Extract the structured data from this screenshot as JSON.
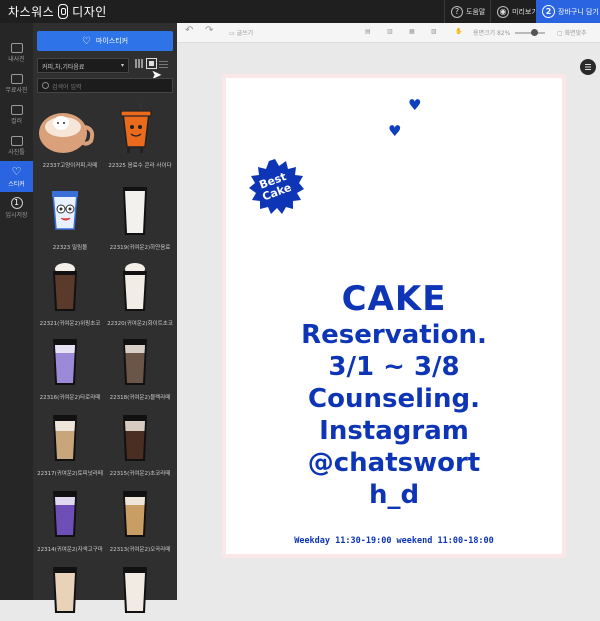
{
  "topbar": {
    "brand_left": "차스워스",
    "brand_right": "디자인",
    "help_num": "?",
    "help_label": "도움말",
    "preview_label": "미리보기",
    "cart_num": "2",
    "cart_label": "장바구니 담기"
  },
  "rail": {
    "items": [
      {
        "label": "내사진"
      },
      {
        "label": "무료사진"
      },
      {
        "label": "컬러"
      },
      {
        "label": "사진틀"
      },
      {
        "label": "스티커"
      },
      {
        "label": "임시저장",
        "num": "1"
      }
    ]
  },
  "panel": {
    "my_sticker_label": "마이스티커",
    "category_value": "커피,차,기타음료",
    "search_placeholder": "검색어 입력",
    "stickers": [
      {
        "caption": "22337고양이커피,라떼"
      },
      {
        "caption": "22325 음료수 콘라 사이다"
      },
      {
        "caption": "22323 밀림몰"
      },
      {
        "caption": "22319(귀여운2)하얀음료"
      },
      {
        "caption": "22321(귀여운2)위핑초코"
      },
      {
        "caption": "22320(귀여운2)화이트초코"
      },
      {
        "caption": "22316(귀여운2)타로라떼"
      },
      {
        "caption": "22318(귀여운2)블랙라떼"
      },
      {
        "caption": "22317(귀여운2)토피넛라떼"
      },
      {
        "caption": "22315(귀여운2)초코라떼"
      },
      {
        "caption": "22314(귀여운2)자색고구마"
      },
      {
        "caption": "22313(귀여운2)오곡라떼"
      },
      {
        "caption": ""
      },
      {
        "caption": ""
      }
    ]
  },
  "toolbar": {
    "undo": "↶",
    "redo": "↷",
    "tool_label": "글쓰기",
    "zoom_label": "용면크기 82%",
    "fit_label": "화면맞추"
  },
  "design": {
    "badge_line1": "Best",
    "badge_line2": "Cake",
    "heart": "♥",
    "lines": [
      "CAKE",
      "Reservation.",
      "3/1 ~ 3/8",
      "Counseling.",
      "Instagram",
      "@chatswort",
      "h_d"
    ],
    "footer": "Weekday 11:30-19:00 weekend 11:00-18:00"
  },
  "colors": {
    "accent": "#2a64e0",
    "text_blue": "#0d35b5",
    "page_border": "#fbe7e7"
  }
}
